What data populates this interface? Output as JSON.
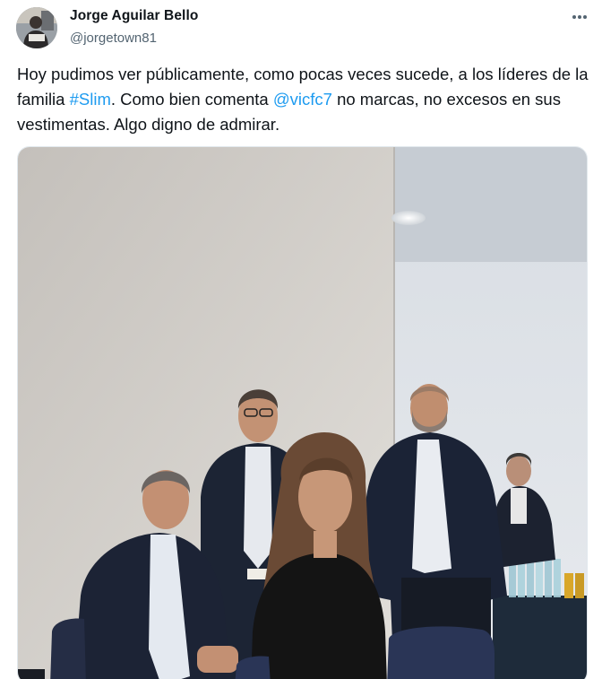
{
  "author": {
    "display_name": "Jorge Aguilar Bello",
    "handle": "@jorgetown81",
    "avatar_icon": "user-avatar"
  },
  "tweet": {
    "text_parts": [
      "Hoy pudimos ver públicamente,  como pocas veces sucede, a los líderes de la familia ",
      "#Slim",
      ". Como bien comenta ",
      "@vicfc7",
      " no marcas, no excesos en sus vestimentas. Algo digno de admirar."
    ],
    "link_color": "#1d9bf0"
  },
  "more_icon": "more-horizontal-icon",
  "media": {
    "type": "photo"
  }
}
